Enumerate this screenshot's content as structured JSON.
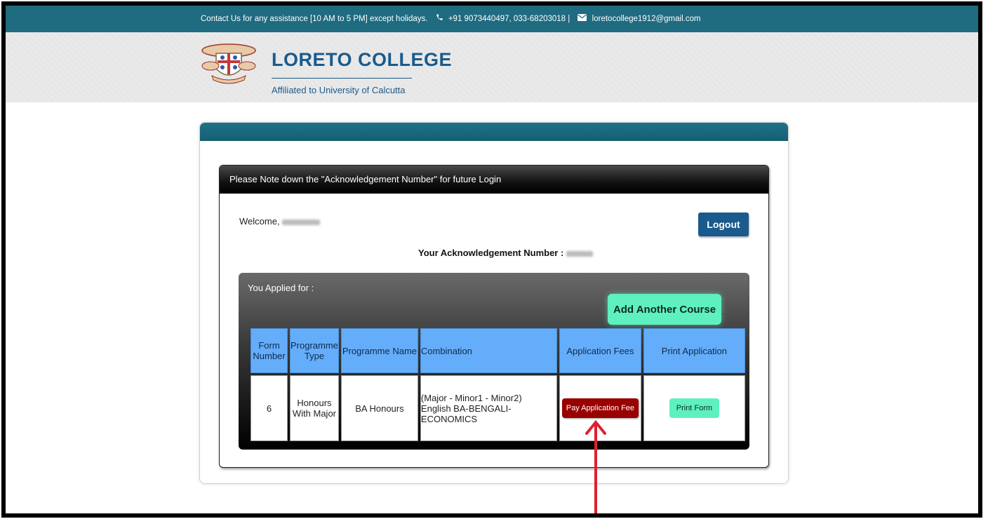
{
  "topbar": {
    "contact_text": "Contact Us for any assistance [10 AM to 5 PM] except holidays.",
    "phone": "+91 9073440497, 033-68203018 |",
    "email": "loretocollege1912@gmail.com"
  },
  "brand": {
    "name": "LORETO COLLEGE",
    "affiliation": "Affiliated to University of Calcutta"
  },
  "panel": {
    "header": "Please Note down the \"Acknowledgement Number\" for future Login",
    "welcome_label": "Welcome,",
    "logout_label": "Logout",
    "ack_label": "Your Acknowledgement Number :"
  },
  "applied": {
    "label": "You Applied for :",
    "add_course_label": "Add Another Course",
    "columns": [
      "Form Number",
      "Programme Type",
      "Programme Name",
      "Combination",
      "Application Fees",
      "Print Application"
    ],
    "rows": [
      {
        "form_number": "6",
        "programme_type": "Honours With Major",
        "programme_name": "BA Honours",
        "combination_line1": "(Major - Minor1 - Minor2)",
        "combination_line2": "English BA-BENGALI-ECONOMICS",
        "pay_label": "Pay Application Fee",
        "print_label": "Print Form"
      }
    ]
  },
  "colors": {
    "topbar": "#1f6b80",
    "brand_blue": "#1a5a8c",
    "table_header": "#64adfa",
    "pay_button": "#990000",
    "mint_button": "#5ff0bf",
    "annotation_arrow": "#e0202f"
  }
}
